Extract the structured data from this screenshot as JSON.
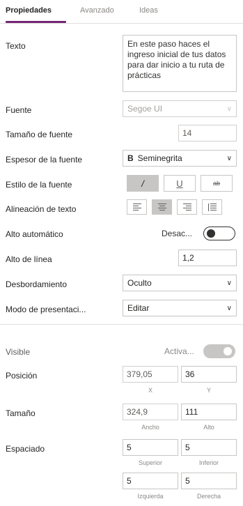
{
  "tabs": {
    "properties": "Propiedades",
    "advanced": "Avanzado",
    "ideas": "Ideas"
  },
  "text": {
    "label": "Texto",
    "value": "En este paso haces el ingreso inicial de tus datos para dar inicio a tu ruta de prácticas"
  },
  "font": {
    "label": "Fuente",
    "value": "Segoe UI"
  },
  "font_size": {
    "label": "Tamaño de fuente",
    "value": "14"
  },
  "font_weight": {
    "label": "Espesor de la fuente",
    "icon_glyph": "B",
    "value": "Seminegrita"
  },
  "font_style": {
    "label": "Estilo de la fuente",
    "italic": "/",
    "underline": "U",
    "strike": "ab"
  },
  "text_align": {
    "label": "Alineación de texto",
    "active": "center"
  },
  "auto_height": {
    "label": "Alto automático",
    "value": "Desac..."
  },
  "line_height": {
    "label": "Alto de línea",
    "value": "1,2"
  },
  "overflow": {
    "label": "Desbordamiento",
    "value": "Oculto"
  },
  "display_mode": {
    "label": "Modo de presentaci...",
    "value": "Editar"
  },
  "visible": {
    "label": "Visible",
    "value": "Activa..."
  },
  "position": {
    "label": "Posición",
    "x": "379,05",
    "y": "36",
    "x_caption": "X",
    "y_caption": "Y"
  },
  "size": {
    "label": "Tamaño",
    "width": "324,9",
    "height": "111",
    "width_caption": "Ancho",
    "height_caption": "Alto"
  },
  "padding": {
    "label": "Espaciado",
    "top": "5",
    "bottom": "5",
    "left": "5",
    "right": "5",
    "top_caption": "Superior",
    "bottom_caption": "Inferior",
    "left_caption": "Izquierda",
    "right_caption": "Derecha"
  },
  "colors": {
    "accent": "#742774",
    "border": "#c8c6c4"
  },
  "icons": {
    "chevron": "chevron-down-icon"
  }
}
